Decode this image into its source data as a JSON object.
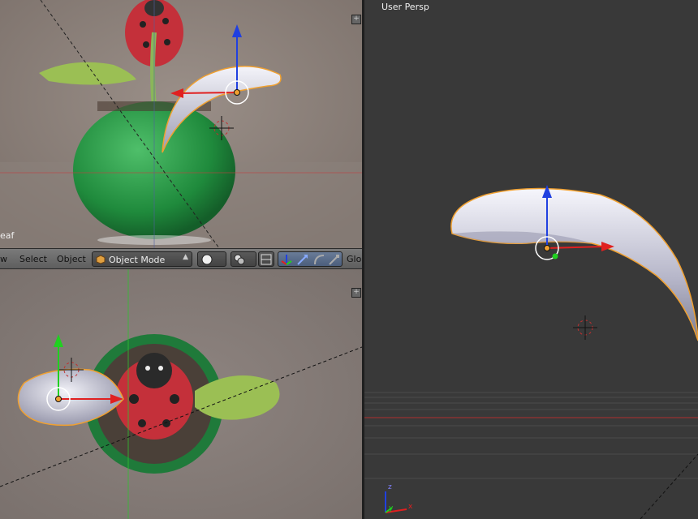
{
  "viewports": {
    "front": {
      "object_label": "eaf"
    },
    "persp": {
      "view_label": "User Persp"
    }
  },
  "header": {
    "menu": [
      "w",
      "Select",
      "Object"
    ],
    "mode": "Object Mode",
    "orientation_label": "Glo"
  },
  "axis_gizmo": {
    "x": "x",
    "y": "y",
    "z": "z"
  },
  "colors": {
    "x_axis": "#e02020",
    "y_axis": "#20d020",
    "z_axis": "#2040e0",
    "selection_outline": "#f0a030"
  },
  "icons": [
    "cube-mode-icon",
    "shading-sphere-icon",
    "pivot-icon",
    "snap-icon",
    "manipulator-icon",
    "translate-icon",
    "rotate-icon",
    "scale-icon"
  ]
}
